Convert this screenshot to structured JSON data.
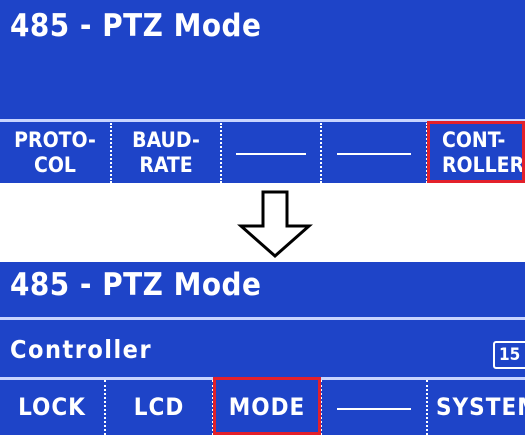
{
  "top_screen": {
    "title": "485 - PTZ Mode",
    "softkeys": [
      {
        "label": "PROTO-\nCOL",
        "empty": false,
        "highlighted": false
      },
      {
        "label": "BAUD-\nRATE",
        "empty": false,
        "highlighted": false
      },
      {
        "label": "",
        "empty": true,
        "highlighted": false
      },
      {
        "label": "",
        "empty": true,
        "highlighted": false
      },
      {
        "label": "CONT-\nROLLER",
        "empty": false,
        "highlighted": true
      }
    ]
  },
  "transition": {
    "icon": "down-arrow-icon"
  },
  "bottom_screen": {
    "title": "485 - PTZ Mode",
    "subtitle": "Controller",
    "badge": "15",
    "softkeys": [
      {
        "label": "LOCK",
        "empty": false,
        "highlighted": false
      },
      {
        "label": "LCD",
        "empty": false,
        "highlighted": false
      },
      {
        "label": "MODE",
        "empty": false,
        "highlighted": true
      },
      {
        "label": "",
        "empty": true,
        "highlighted": false
      },
      {
        "label": "SYSTEM",
        "empty": false,
        "highlighted": false
      }
    ]
  },
  "colors": {
    "screen_bg": "#1e44c8",
    "text": "#ffffff",
    "highlight": "#e3202a",
    "divider": "#c8d4ff"
  }
}
